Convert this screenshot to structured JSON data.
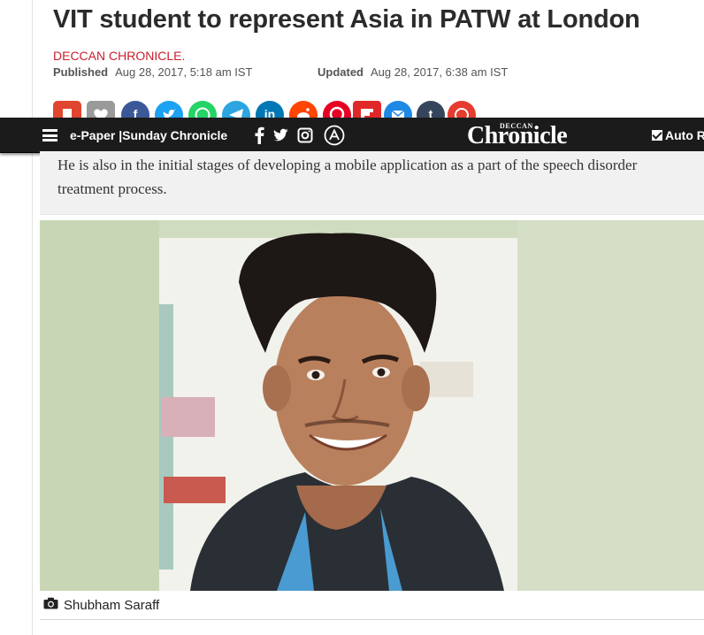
{
  "article": {
    "headline": "VIT student to represent Asia in PATW at London",
    "source": "DECCAN CHRONICLE.",
    "published_label": "Published",
    "published_value": "Aug 28, 2017, 5:18 am IST",
    "updated_label": "Updated",
    "updated_value": "Aug 28, 2017, 6:38 am IST",
    "pull_quote": "He is also in the initial stages of developing a mobile application as a part of the speech disorder treatment process.",
    "photo_caption": "Shubham Saraff"
  },
  "share_buttons": [
    {
      "icon": "bookmark-icon",
      "color": "#e0452f"
    },
    {
      "icon": "heart-icon",
      "color": "#9a9a9a"
    },
    {
      "icon": "facebook-icon",
      "glyph": "f",
      "color": "#3b5998"
    },
    {
      "icon": "twitter-icon",
      "color": "#1da1f2"
    },
    {
      "icon": "whatsapp-icon",
      "color": "#25d366"
    },
    {
      "icon": "telegram-icon",
      "color": "#2ca5e0"
    },
    {
      "icon": "linkedin-icon",
      "glyph": "in",
      "color": "#0077b5"
    },
    {
      "icon": "reddit-icon",
      "color": "#ff4500"
    },
    {
      "icon": "pinterest-icon",
      "color": "#e60023"
    },
    {
      "icon": "flipboard-icon",
      "color": "#e12828"
    },
    {
      "icon": "email-icon",
      "color": "#1e88e5"
    },
    {
      "icon": "tumblr-icon",
      "glyph": "t",
      "color": "#35465c"
    },
    {
      "icon": "yahoo-icon",
      "color": "#e63b2e"
    }
  ],
  "navbar": {
    "links_label": "e-Paper |Sunday Chronicle",
    "logo_small": "DECCAN",
    "logo_big": "Chronicle",
    "auto_label": "Auto R",
    "social_icons": [
      "facebook-icon",
      "twitter-icon",
      "instagram-icon",
      "app-store-icon"
    ]
  },
  "colors": {
    "navbar_bg": "#1b1b1b",
    "source_red": "#c8202d",
    "quote_bg": "#f1f1f1"
  }
}
